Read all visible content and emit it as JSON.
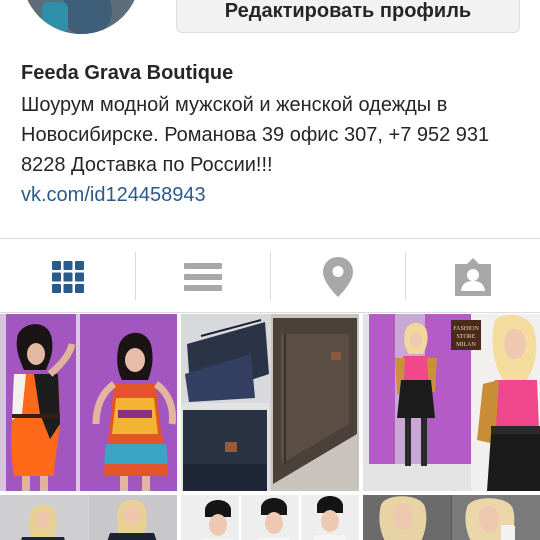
{
  "profile": {
    "edit_button": "Редактировать профиль",
    "name": "Feeda Grava Boutique",
    "bio": "Шоурум модной мужской и женской одежды в Новосибирске. Романова 39 офис 307, +7 952 931 8228 Доставка по России!!!",
    "link": "vk.com/id124458943"
  },
  "tabs": [
    {
      "id": "grid",
      "icon": "grid-icon",
      "active": true
    },
    {
      "id": "list",
      "icon": "list-icon",
      "active": false
    },
    {
      "id": "map",
      "icon": "map-pin-icon",
      "active": false
    },
    {
      "id": "tagged",
      "icon": "tagged-person-icon",
      "active": false
    }
  ],
  "photo_signs": {
    "sign_line1": "FASHION",
    "sign_line2": "STORE",
    "sign_line3": "MILAN"
  },
  "colors": {
    "active_tab": "#2a5a8c",
    "inactive_tab": "#a8a8a8",
    "link": "#2a5a8c"
  }
}
